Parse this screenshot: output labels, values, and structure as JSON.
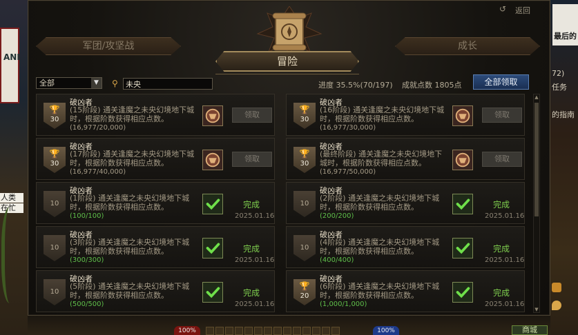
{
  "window": {
    "back_label": "返回",
    "tabs": {
      "left": "军团/攻坚战",
      "center": "冒险",
      "right": "成长"
    }
  },
  "filter": {
    "category_selected": "全部",
    "search_value": "未央",
    "progress_text": "进度 35.5%(70/197)",
    "points_text": "成就点数 1805点",
    "claim_all_label": "全部领取"
  },
  "achievements": [
    {
      "name": "破凶者",
      "desc": "(15阶段) 通关逢魔之未央幻境地下城时，根据阶数获得相应点数。",
      "progress": "(16,977/20,000)",
      "points": "30",
      "state": "claim",
      "action": "领取",
      "date": ""
    },
    {
      "name": "破凶者",
      "desc": "(16阶段) 通关逢魔之未央幻境地下城时，根据阶数获得相应点数。",
      "progress": "(16,977/30,000)",
      "points": "30",
      "state": "claim",
      "action": "领取",
      "date": ""
    },
    {
      "name": "破凶者",
      "desc": "(17阶段) 通关逢魔之未央幻境地下城时，根据阶数获得相应点数。",
      "progress": "(16,977/40,000)",
      "points": "30",
      "state": "claim",
      "action": "领取",
      "date": ""
    },
    {
      "name": "破凶者",
      "desc": "(最终阶段) 通关逢魔之未央幻境地下城时，根据阶数获得相应点数。",
      "progress": "(16,977/50,000)",
      "points": "30",
      "state": "claim",
      "action": "领取",
      "date": ""
    },
    {
      "name": "破凶者",
      "desc": "(1阶段) 通关逢魔之未央幻境地下城时，根据阶数获得相应点数。",
      "progress": "(100/100)",
      "points": "10",
      "state": "done",
      "action": "完成",
      "date": "2025.01.16"
    },
    {
      "name": "破凶者",
      "desc": "(2阶段) 通关逢魔之未央幻境地下城时，根据阶数获得相应点数。",
      "progress": "(200/200)",
      "points": "10",
      "state": "done",
      "action": "完成",
      "date": "2025.01.16"
    },
    {
      "name": "破凶者",
      "desc": "(3阶段) 通关逢魔之未央幻境地下城时，根据阶数获得相应点数。",
      "progress": "(300/300)",
      "points": "10",
      "state": "done",
      "action": "完成",
      "date": "2025.01.16"
    },
    {
      "name": "破凶者",
      "desc": "(4阶段) 通关逢魔之未央幻境地下城时，根据阶数获得相应点数。",
      "progress": "(400/400)",
      "points": "10",
      "state": "done",
      "action": "完成",
      "date": "2025.01.16"
    },
    {
      "name": "破凶者",
      "desc": "(5阶段) 通关逢魔之未央幻境地下城时，根据阶数获得相应点数。",
      "progress": "(500/500)",
      "points": "10",
      "state": "done",
      "action": "完成",
      "date": "2025.01.16"
    },
    {
      "name": "破凶者",
      "desc": "(6阶段) 通关逢魔之未央幻境地下城时，根据阶数获得相应点数。",
      "progress": "(1,000/1,000)",
      "points": "20",
      "state": "done",
      "action": "完成",
      "date": "2025.01.16"
    }
  ],
  "background": {
    "left_banner": "ANI",
    "left_chip_1": "人类",
    "left_chip_2": "在忙",
    "right_poster": "最后的",
    "right_text_1": "72)",
    "right_text_2": "任务",
    "right_text_3": "的指南",
    "hp_1": "100%",
    "hp_2": "100%",
    "city_label": "商城"
  },
  "colors": {
    "accent_gold": "#a48c5d",
    "claim_all_blue": "#2c4b7a",
    "done_green": "#7fcf4e"
  }
}
